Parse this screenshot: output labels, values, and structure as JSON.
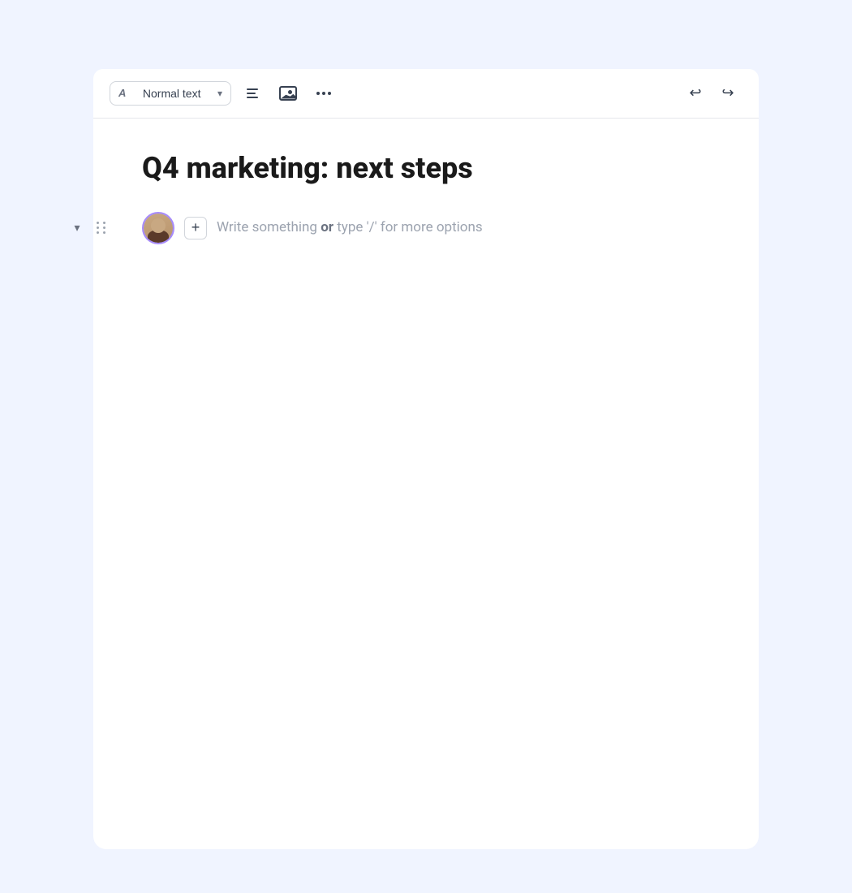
{
  "toolbar": {
    "text_style_label": "Normal text",
    "text_icon": "A",
    "undo_label": "Undo",
    "redo_label": "Redo"
  },
  "document": {
    "title": "Q4 marketing: next steps",
    "placeholder_part1": "Write something ",
    "placeholder_bold": "or",
    "placeholder_part2": " type '/' for more options"
  },
  "icons": {
    "collapse": "chevron-down",
    "drag": "drag-handle",
    "add_block": "+",
    "list": "list-icon",
    "image": "image-icon",
    "more": "more-icon",
    "undo": "undo-icon",
    "redo": "redo-icon"
  }
}
